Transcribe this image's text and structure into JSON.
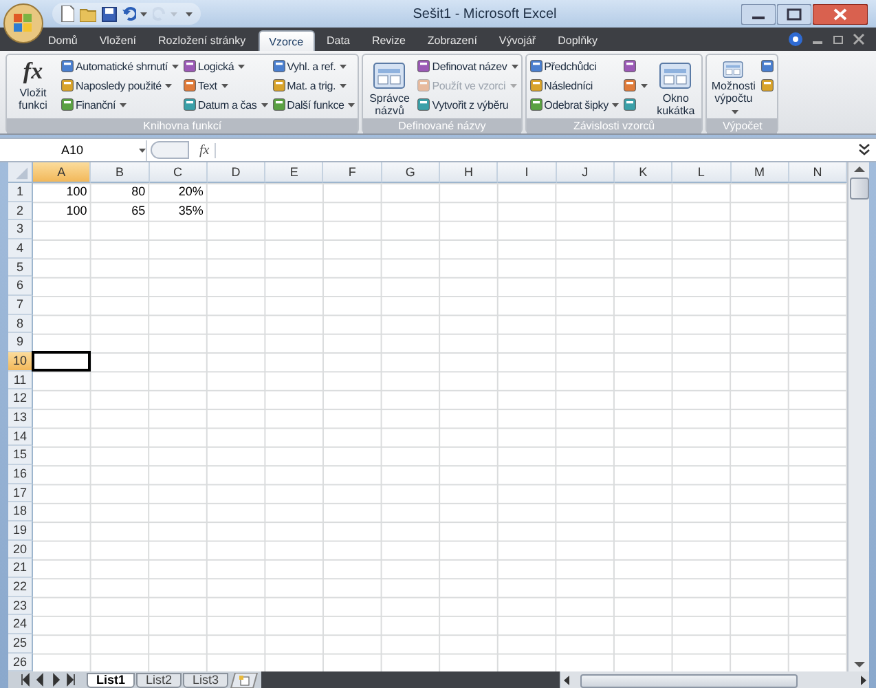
{
  "window": {
    "title": "Sešit1 - Microsoft Excel"
  },
  "ribbon_tabs": [
    {
      "label": "Domů",
      "selected": false
    },
    {
      "label": "Vložení",
      "selected": false
    },
    {
      "label": "Rozložení stránky",
      "selected": false
    },
    {
      "label": "Vzorce",
      "selected": true
    },
    {
      "label": "Data",
      "selected": false
    },
    {
      "label": "Revize",
      "selected": false
    },
    {
      "label": "Zobrazení",
      "selected": false
    },
    {
      "label": "Vývojář",
      "selected": false
    },
    {
      "label": "Doplňky",
      "selected": false
    }
  ],
  "ribbon_groups": [
    {
      "title": "Knihovna funkcí",
      "columns": [
        [
          {
            "kind": "big",
            "label": "Vložit funkci",
            "glyph": "fx",
            "menu": false,
            "disabled": false
          }
        ],
        [
          {
            "kind": "small",
            "label": "Automatické shrnutí",
            "menu": true,
            "disabled": false
          },
          {
            "kind": "small",
            "label": "Naposledy použité",
            "menu": true,
            "disabled": false
          },
          {
            "kind": "small",
            "label": "Finanční",
            "menu": true,
            "disabled": false
          }
        ],
        [
          {
            "kind": "small",
            "label": "Logická",
            "menu": true,
            "disabled": false
          },
          {
            "kind": "small",
            "label": "Text",
            "menu": true,
            "disabled": false
          },
          {
            "kind": "small",
            "label": "Datum a čas",
            "menu": true,
            "disabled": false
          }
        ],
        [
          {
            "kind": "small",
            "label": "Vyhl. a ref.",
            "menu": true,
            "disabled": false
          },
          {
            "kind": "small",
            "label": "Mat. a trig.",
            "menu": true,
            "disabled": false
          },
          {
            "kind": "small",
            "label": "Další funkce",
            "menu": true,
            "disabled": false
          }
        ]
      ]
    },
    {
      "title": "Definované názvy",
      "columns": [
        [
          {
            "kind": "big",
            "label": "Správce názvů",
            "menu": false,
            "disabled": false
          }
        ],
        [
          {
            "kind": "small",
            "label": "Definovat název",
            "menu": true,
            "disabled": false
          },
          {
            "kind": "small",
            "label": "Použít ve vzorci",
            "menu": true,
            "disabled": true
          },
          {
            "kind": "small",
            "label": "Vytvořit z výběru",
            "menu": false,
            "disabled": false
          }
        ]
      ]
    },
    {
      "title": "Závislosti vzorců",
      "columns": [
        [
          {
            "kind": "small",
            "label": "Předchůdci",
            "menu": false,
            "disabled": false
          },
          {
            "kind": "small",
            "label": "Následníci",
            "menu": false,
            "disabled": false
          },
          {
            "kind": "small",
            "label": "Odebrat šipky",
            "menu": true,
            "disabled": false
          }
        ],
        [
          {
            "kind": "icon",
            "menu": false,
            "disabled": false
          },
          {
            "kind": "icon",
            "menu": true,
            "disabled": false
          },
          {
            "kind": "icon",
            "menu": false,
            "disabled": false
          }
        ],
        [
          {
            "kind": "big",
            "label": "Okno kukátka",
            "menu": false,
            "disabled": false
          }
        ]
      ]
    },
    {
      "title": "Výpočet",
      "columns": [
        [
          {
            "kind": "big",
            "label": "Možnosti výpočtu",
            "menu": true,
            "disabled": false
          }
        ],
        [
          {
            "kind": "icon",
            "menu": false,
            "disabled": false
          },
          {
            "kind": "icon",
            "menu": false,
            "disabled": false
          }
        ]
      ]
    }
  ],
  "formula_bar": {
    "name_box": "A10",
    "fx": "fx"
  },
  "columns": [
    {
      "label": "A",
      "selected": true
    },
    {
      "label": "B",
      "selected": false
    },
    {
      "label": "C",
      "selected": false
    },
    {
      "label": "D",
      "selected": false
    },
    {
      "label": "E",
      "selected": false
    },
    {
      "label": "F",
      "selected": false
    },
    {
      "label": "G",
      "selected": false
    },
    {
      "label": "H",
      "selected": false
    },
    {
      "label": "I",
      "selected": false
    },
    {
      "label": "J",
      "selected": false
    },
    {
      "label": "K",
      "selected": false
    },
    {
      "label": "L",
      "selected": false
    },
    {
      "label": "M",
      "selected": false
    },
    {
      "label": "N",
      "selected": false
    }
  ],
  "rows": [
    {
      "label": "1",
      "selected": false,
      "cells": [
        "100",
        "80",
        "20%"
      ]
    },
    {
      "label": "2",
      "selected": false,
      "cells": [
        "100",
        "65",
        "35%"
      ]
    },
    {
      "label": "3",
      "selected": false
    },
    {
      "label": "4",
      "selected": false
    },
    {
      "label": "5",
      "selected": false
    },
    {
      "label": "6",
      "selected": false
    },
    {
      "label": "7",
      "selected": false
    },
    {
      "label": "8",
      "selected": false
    },
    {
      "label": "9",
      "selected": false
    },
    {
      "label": "10",
      "selected": true
    },
    {
      "label": "11",
      "selected": false
    },
    {
      "label": "12",
      "selected": false
    },
    {
      "label": "13",
      "selected": false
    },
    {
      "label": "14",
      "selected": false
    },
    {
      "label": "15",
      "selected": false
    },
    {
      "label": "16",
      "selected": false
    },
    {
      "label": "17",
      "selected": false
    },
    {
      "label": "18",
      "selected": false
    },
    {
      "label": "19",
      "selected": false
    },
    {
      "label": "20",
      "selected": false
    },
    {
      "label": "21",
      "selected": false
    },
    {
      "label": "22",
      "selected": false
    },
    {
      "label": "23",
      "selected": false
    },
    {
      "label": "24",
      "selected": false
    },
    {
      "label": "25",
      "selected": false
    },
    {
      "label": "26",
      "selected": false
    }
  ],
  "sheet_tabs": [
    {
      "label": "List1",
      "selected": true
    },
    {
      "label": "List2",
      "selected": false
    },
    {
      "label": "List3",
      "selected": false
    }
  ]
}
